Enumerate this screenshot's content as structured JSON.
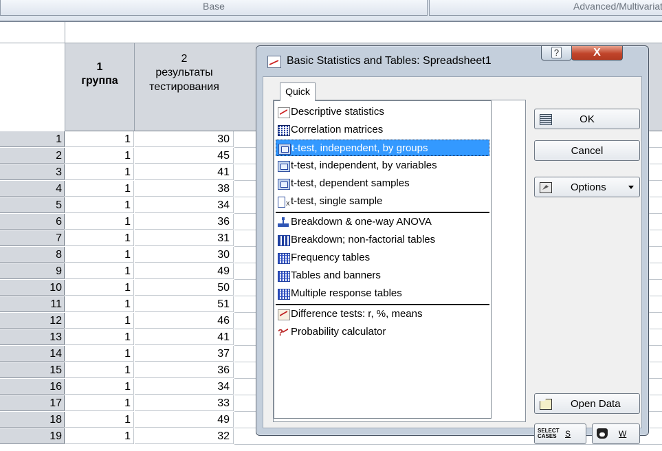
{
  "ribbon": {
    "tabs": [
      "Base",
      "Advanced/Multivariat"
    ]
  },
  "spreadsheet": {
    "columns": [
      {
        "num": "1",
        "name": "группа"
      },
      {
        "num": "2",
        "name_lines": [
          "результаты",
          "тестирования"
        ]
      }
    ],
    "rows": [
      [
        "1",
        "1",
        "30"
      ],
      [
        "2",
        "1",
        "45"
      ],
      [
        "3",
        "1",
        "41"
      ],
      [
        "4",
        "1",
        "38"
      ],
      [
        "5",
        "1",
        "34"
      ],
      [
        "6",
        "1",
        "36"
      ],
      [
        "7",
        "1",
        "31"
      ],
      [
        "8",
        "1",
        "30"
      ],
      [
        "9",
        "1",
        "49"
      ],
      [
        "10",
        "1",
        "50"
      ],
      [
        "11",
        "1",
        "51"
      ],
      [
        "12",
        "1",
        "46"
      ],
      [
        "13",
        "1",
        "41"
      ],
      [
        "14",
        "1",
        "37"
      ],
      [
        "15",
        "1",
        "36"
      ],
      [
        "16",
        "1",
        "34"
      ],
      [
        "17",
        "1",
        "33"
      ],
      [
        "18",
        "1",
        "49"
      ],
      [
        "19",
        "1",
        "32"
      ]
    ]
  },
  "dialog": {
    "title": "Basic Statistics and Tables: Spreadsheet1",
    "help_label": "?",
    "close_label": "X",
    "tab_label": "Quick",
    "items": [
      {
        "label": "Descriptive statistics",
        "icon": "descriptive-icon"
      },
      {
        "label": "Correlation matrices",
        "icon": "matrix-icon"
      },
      {
        "label": "t-test, independent, by groups",
        "icon": "t-test-icon",
        "selected": true
      },
      {
        "label": "t-test, independent, by variables",
        "icon": "t-test-icon"
      },
      {
        "label": "t-test, dependent samples",
        "icon": "t-test-icon"
      },
      {
        "label": "t-test, single sample",
        "icon": "t-single-icon"
      },
      {
        "label": "Breakdown & one-way ANOVA",
        "icon": "breakdown-icon"
      },
      {
        "label": "Breakdown; non-factorial tables",
        "icon": "bars-icon"
      },
      {
        "label": "Frequency tables",
        "icon": "table-icon"
      },
      {
        "label": "Tables and banners",
        "icon": "table-icon"
      },
      {
        "label": "Multiple response tables",
        "icon": "table-icon"
      },
      {
        "label": "Difference tests: r, %, means",
        "icon": "difference-icon"
      },
      {
        "label": "Probability calculator",
        "icon": "probability-icon"
      }
    ],
    "buttons": {
      "ok": "OK",
      "cancel": "Cancel",
      "options": "Options",
      "open_data": "Open Data",
      "select_cases_icon_text": "SELECT CASES",
      "select_cases_key": "S",
      "weight_key": "W"
    },
    "selection_color": "#3399ff"
  }
}
